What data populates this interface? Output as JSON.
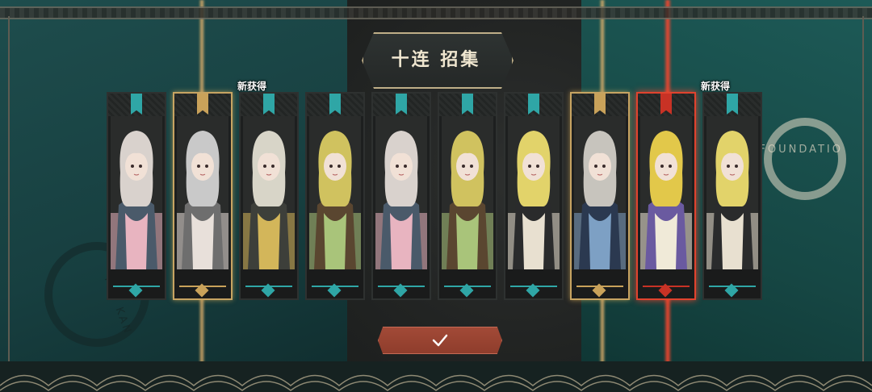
{
  "title": "十连 招集",
  "seal_right_text": "FOUNDATIO",
  "seal_left_text": "ION KAN",
  "new_badge": "新获得",
  "confirm_icon": "checkmark-icon",
  "colors": {
    "teal": "#2fa6a6",
    "gold": "#c9a25a",
    "red": "#c83225",
    "confirm": "#9b4634"
  },
  "cards": [
    {
      "rarity": "teal",
      "new": false,
      "palette": [
        "#d9d2cd",
        "#4a5a6a",
        "#e8b4c0"
      ]
    },
    {
      "rarity": "gold",
      "new": true,
      "palette": [
        "#c9c9c9",
        "#6e6e6e",
        "#e8e0da"
      ]
    },
    {
      "rarity": "teal",
      "new": false,
      "palette": [
        "#d8d5c8",
        "#3d3f3a",
        "#d3b65a"
      ]
    },
    {
      "rarity": "teal",
      "new": false,
      "palette": [
        "#d0c25f",
        "#5a4630",
        "#a9c47a"
      ]
    },
    {
      "rarity": "teal",
      "new": false,
      "palette": [
        "#d9d2cd",
        "#4a5a6a",
        "#e8b4c0"
      ]
    },
    {
      "rarity": "teal",
      "new": false,
      "palette": [
        "#d0c25f",
        "#5a4630",
        "#a9c47a"
      ]
    },
    {
      "rarity": "teal",
      "new": false,
      "palette": [
        "#e2d36a",
        "#2a2b2c",
        "#e8e0d0"
      ]
    },
    {
      "rarity": "gold",
      "new": false,
      "palette": [
        "#c7c4bd",
        "#2b3950",
        "#7da0c4"
      ]
    },
    {
      "rarity": "red",
      "new": true,
      "palette": [
        "#e2c84a",
        "#6a5aa0",
        "#f0ead8"
      ]
    },
    {
      "rarity": "teal",
      "new": false,
      "palette": [
        "#e2d36a",
        "#2a2b2c",
        "#e8e0d0"
      ]
    }
  ]
}
